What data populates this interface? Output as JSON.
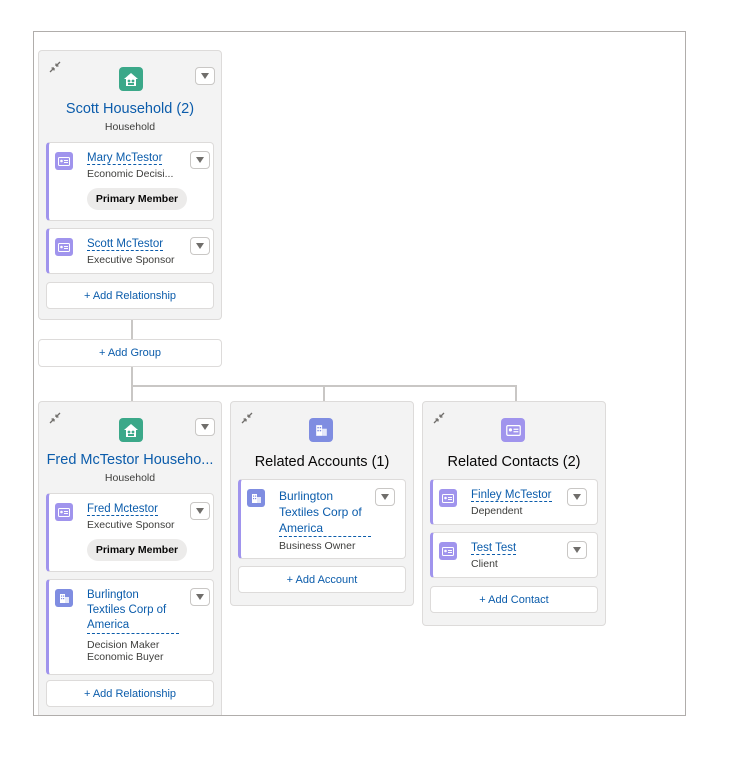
{
  "household_1": {
    "title": "Scott Household (2)",
    "subtitle": "Household",
    "members": [
      {
        "name": "Mary McTestor",
        "role": "Economic Decisi...",
        "badge": "Primary Member"
      },
      {
        "name": "Scott McTestor",
        "role": "Executive Sponsor"
      }
    ],
    "add_relationship_label": "+ Add Relationship"
  },
  "add_group_label": "+ Add Group",
  "household_2": {
    "title": "Fred McTestor Househo...",
    "subtitle": "Household",
    "members": [
      {
        "name": "Fred Mctestor",
        "role": "Executive Sponsor",
        "badge": "Primary Member"
      },
      {
        "name_lines": [
          "Burlington",
          "Textiles Corp of",
          "America"
        ],
        "role_lines": [
          "Decision Maker",
          "Economic Buyer"
        ]
      }
    ],
    "add_relationship_label": "+ Add Relationship"
  },
  "related_accounts": {
    "title": "Related Accounts (1)",
    "items": [
      {
        "name_lines": [
          "Burlington",
          "Textiles Corp of",
          "America"
        ],
        "role": "Business Owner"
      }
    ],
    "add_label": "+ Add Account"
  },
  "related_contacts": {
    "title": "Related Contacts (2)",
    "items": [
      {
        "name": "Finley McTestor",
        "role": "Dependent"
      },
      {
        "name": "Test Test",
        "role": "Client"
      }
    ],
    "add_label": "+ Add Contact"
  },
  "icons": {
    "household": "household-icon",
    "contact": "contact-card-icon",
    "account": "account-building-icon",
    "collapse": "collapse-icon",
    "menu": "chevron-down-icon"
  },
  "colors": {
    "link": "#0b5cab",
    "household_icon": "#3ba889",
    "contact_icon": "#a094ed",
    "account_icon": "#7f8de1",
    "card_bg": "#f3f3f3"
  }
}
